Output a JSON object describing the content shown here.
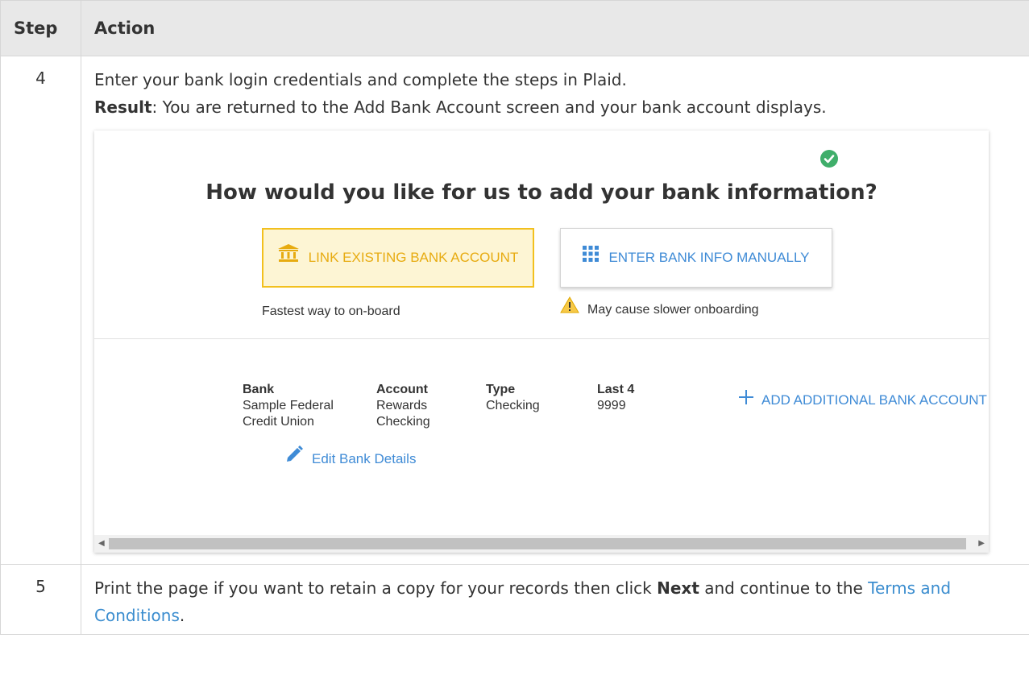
{
  "table": {
    "headers": {
      "step": "Step",
      "action": "Action"
    },
    "rows": [
      {
        "step": "4",
        "line1": "Enter your bank login credentials and complete the steps in Plaid.",
        "result_label": "Result",
        "result_text": ": You are returned to the Add Bank Account screen and your bank account displays."
      },
      {
        "step": "5",
        "text_before": "Print the page if you want to retain a copy for your records then click ",
        "bold": "Next",
        "text_mid": " and continue to the ",
        "link": "Terms and Conditions",
        "text_end": "."
      }
    ]
  },
  "screenshot": {
    "heading": "How would you like for us to add your bank information?",
    "link_button": "LINK EXISTING BANK ACCOUNT",
    "manual_button": "ENTER BANK INFO MANUALLY",
    "link_caption": "Fastest way to on-board",
    "manual_caption": "May cause slower onboarding",
    "columns": {
      "bank": {
        "header": "Bank",
        "line1": "Sample Federal",
        "line2": "Credit Union"
      },
      "account": {
        "header": "Account",
        "line1": "Rewards",
        "line2": "Checking"
      },
      "type": {
        "header": "Type",
        "line1": "Checking"
      },
      "last4": {
        "header": "Last 4",
        "line1": "9999"
      }
    },
    "add_button": "ADD ADDITIONAL BANK ACCOUNT",
    "edit_link": "Edit Bank Details",
    "icons": [
      "check-circle-icon",
      "bank-icon",
      "grid-icon",
      "warning-icon",
      "plus-icon",
      "pencil-icon"
    ],
    "colors": {
      "accent_blue": "#3f8bd6",
      "link_yellow": "#e7ab10",
      "success_green": "#3fae6a"
    }
  }
}
